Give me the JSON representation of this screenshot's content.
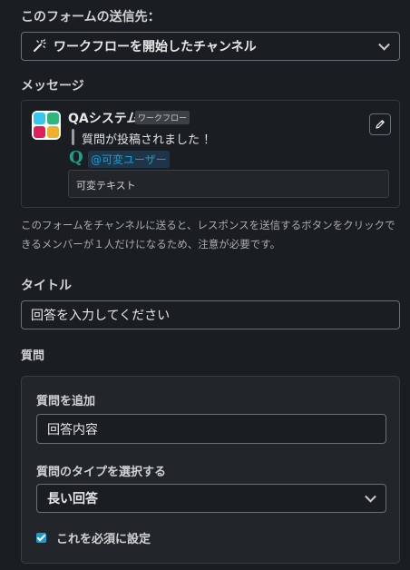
{
  "destination": {
    "label": "このフォームの送信先：",
    "selected": "ワークフローを開始したチャンネル",
    "icon": "magic-wand-icon"
  },
  "message": {
    "label": "メッセージ",
    "bot_name": "QAシステム",
    "badge": "ワークフロー",
    "quote": "質問が投稿されました ！",
    "q_glyph": "Q",
    "mention": "@可変ユーザー",
    "variable_text": "可変テキスト",
    "edit_icon": "pencil-icon",
    "logo_colors": [
      "#36c5f0",
      "#2eb67d",
      "#e01e5a",
      "#ecb22e"
    ]
  },
  "note": "このフォームをチャンネルに送ると、レスポンスを送信するボタンをクリックできるメンバーが１人だけになるため、注意が必要です。",
  "title_field": {
    "label": "タイトル",
    "value": "回答を入力してください"
  },
  "question_section": {
    "label": "質問",
    "add_label": "質問を追加",
    "add_value": "回答内容",
    "type_label": "質問のタイプを選択する",
    "type_selected": "長い回答",
    "required_label": "これを必須に設定",
    "required_checked": true
  },
  "colors": {
    "background": "#1a1d21",
    "accent": "#1d9bd1",
    "q_color": "#20a08a"
  }
}
